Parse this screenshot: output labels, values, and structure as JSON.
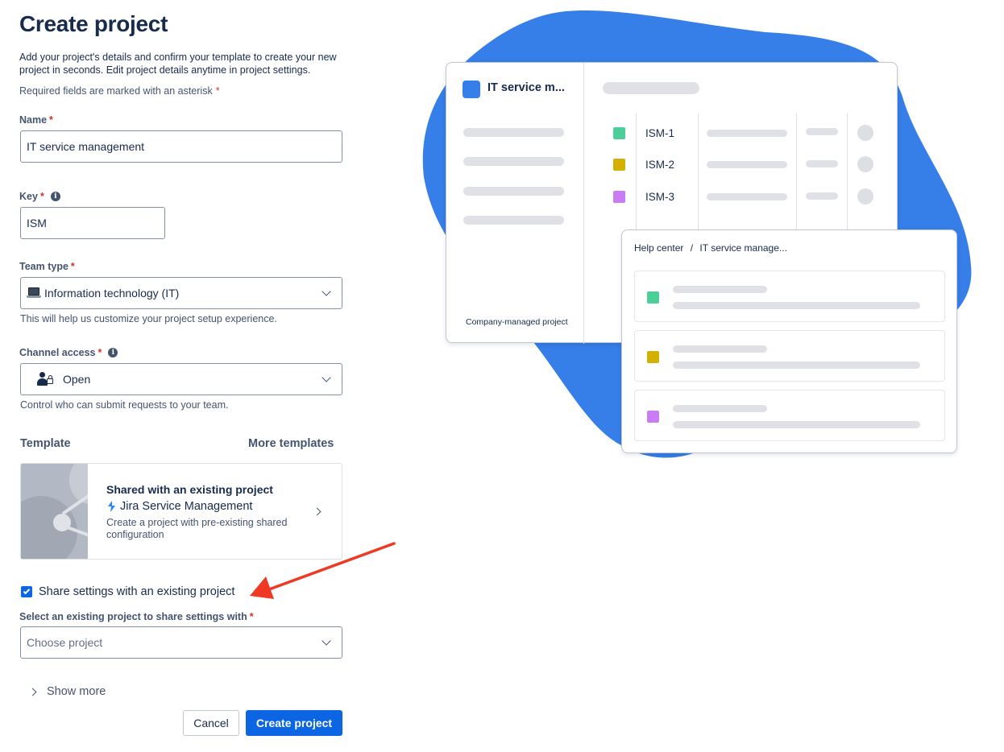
{
  "page": {
    "title": "Create project",
    "intro": "Add your project's details and confirm your template to create your new project in seconds. Edit project details anytime in project settings.",
    "required_note": "Required fields are marked with an asterisk",
    "asterisk": "*"
  },
  "form": {
    "name": {
      "label": "Name",
      "value": "IT service management"
    },
    "key": {
      "label": "Key",
      "value": "ISM",
      "info_icon": "info-icon"
    },
    "team_type": {
      "label": "Team type",
      "value": "Information technology (IT)",
      "icon": "laptop-icon",
      "helper": "This will help us customize your project setup experience."
    },
    "channel_access": {
      "label": "Channel access",
      "value": "Open",
      "icon": "person-lock-icon",
      "helper": "Control who can submit requests to your team."
    },
    "template": {
      "label": "Template",
      "more_link": "More templates",
      "card_title": "Shared with an existing project",
      "product": "Jira Service Management",
      "description": "Create a project with pre-existing shared configuration"
    },
    "share_checkbox": {
      "label": "Share settings with an existing project",
      "checked": true
    },
    "existing_project": {
      "label": "Select an existing project to share settings with",
      "placeholder": "Choose project"
    },
    "show_more": "Show more",
    "cancel": "Cancel",
    "submit": "Create project"
  },
  "illustration": {
    "project_name": "IT service m...",
    "project_type": "Company-managed project",
    "issues": [
      {
        "key": "ISM-1",
        "color": "#4bce97"
      },
      {
        "key": "ISM-2",
        "color": "#d4b000"
      },
      {
        "key": "ISM-3",
        "color": "#c97cf4"
      }
    ],
    "help_center": {
      "crumb_root": "Help center",
      "crumb_sep": "/",
      "crumb_leaf": "IT service manage..."
    },
    "blob_color": "#367ee8",
    "project_square_color": "#367ee8"
  },
  "annotation": {
    "arrow_color": "#ee3a24"
  }
}
